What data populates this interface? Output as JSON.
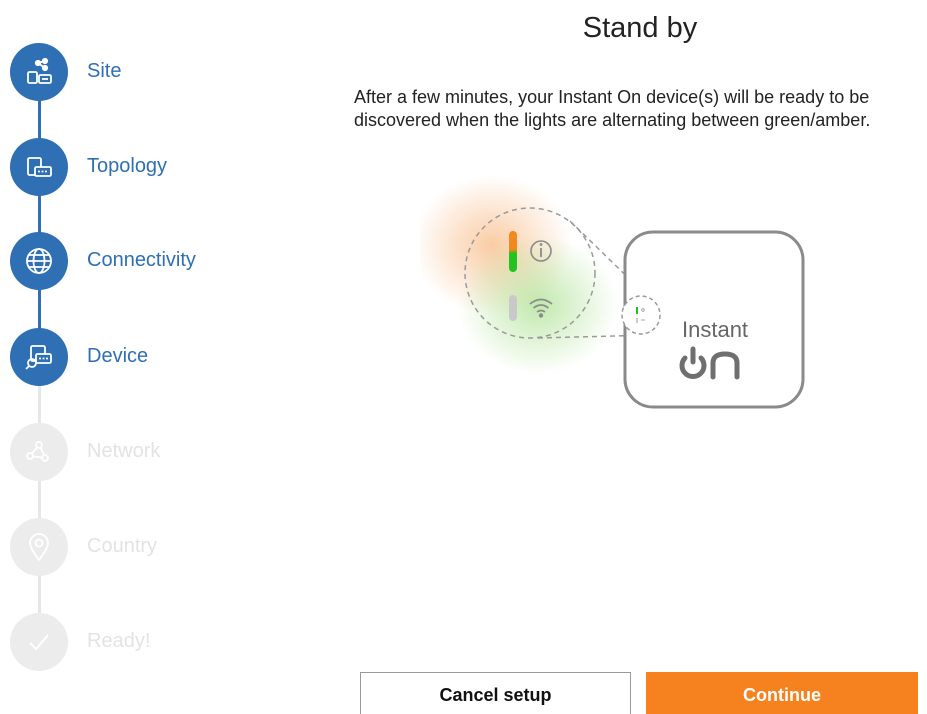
{
  "stepper": {
    "steps": [
      {
        "label": "Site",
        "state": "done",
        "icon": "site-icon"
      },
      {
        "label": "Topology",
        "state": "done",
        "icon": "topology-icon"
      },
      {
        "label": "Connectivity",
        "state": "done",
        "icon": "globe-icon"
      },
      {
        "label": "Device",
        "state": "done",
        "icon": "device-search-icon"
      },
      {
        "label": "Network",
        "state": "todo",
        "icon": "network-icon"
      },
      {
        "label": "Country",
        "state": "todo",
        "icon": "map-pin-icon"
      },
      {
        "label": "Ready!",
        "state": "todo",
        "icon": "checkmark-icon"
      }
    ],
    "colors": {
      "done": "#2f6fb3",
      "todo": "#ececec"
    }
  },
  "main": {
    "title": "Stand by",
    "description": "After a few minutes, your Instant On device(s) will be ready to be discovered when the lights are alternating between green/amber.",
    "device": {
      "brand_text": "Instant",
      "logo_text": "On",
      "led_colors": {
        "green": "#22c31f",
        "amber": "#f08a1e"
      }
    }
  },
  "buttons": {
    "cancel_label": "Cancel setup",
    "continue_label": "Continue",
    "accent": "#f5821f"
  }
}
